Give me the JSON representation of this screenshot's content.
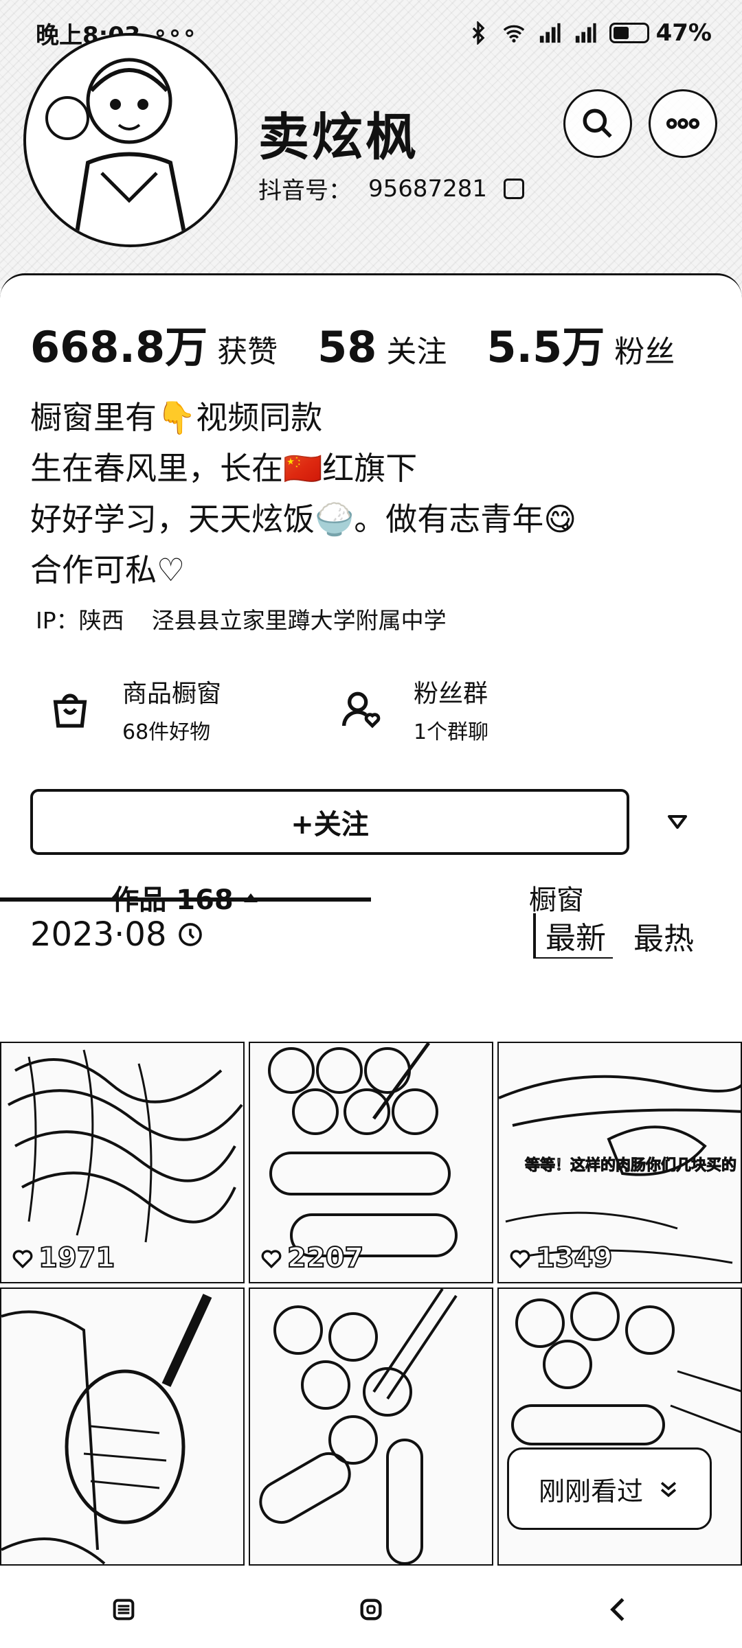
{
  "status_bar": {
    "time": "晚上8:03",
    "notification_dots": "∘∘∘",
    "battery": "47%",
    "battery_level": 0.47
  },
  "profile": {
    "name": "卖炫枫",
    "account_label": "抖音号：",
    "account_id": "95687281"
  },
  "stats": [
    {
      "value": "668.8万",
      "label": "获赞"
    },
    {
      "value": "58",
      "label": "关注"
    },
    {
      "value": "5.5万",
      "label": "粉丝"
    }
  ],
  "bio": {
    "lines": [
      "橱窗里有👇视频同款",
      "生在春风里，长在🇨🇳红旗下",
      "好好学习，天天炫饭🍚。做有志青年😋",
      "合作可私♡"
    ]
  },
  "ip": {
    "label": "IP：陕西",
    "school": "泾县县立家里蹲大学附属中学"
  },
  "features": {
    "shop": {
      "title": "商品橱窗",
      "sub": "68件好物"
    },
    "fans": {
      "title": "粉丝群",
      "sub": "1个群聊"
    }
  },
  "follow_button": "+关注",
  "tabs": {
    "works": "作品 168",
    "shop": "橱窗"
  },
  "filter": {
    "year": "2023·08",
    "latest": "最新",
    "hottest": "最热"
  },
  "videos": [
    {
      "likes": "1971",
      "caption": ""
    },
    {
      "likes": "2207",
      "caption": ""
    },
    {
      "likes": "1349",
      "caption": "等等！这样的肉肠你们几块买的"
    },
    {
      "likes": "",
      "caption": ""
    },
    {
      "likes": "",
      "caption": ""
    },
    {
      "likes": "",
      "caption": ""
    }
  ],
  "recent_button": "刚刚看过",
  "icons": [
    "bluetooth-icon",
    "wifi-icon",
    "signal-icon",
    "search-icon",
    "more-icon",
    "shopping-bag-icon",
    "fans-group-icon",
    "dropdown-icon",
    "clock-icon",
    "heart-icon",
    "menu-icon",
    "home-icon",
    "back-icon"
  ]
}
